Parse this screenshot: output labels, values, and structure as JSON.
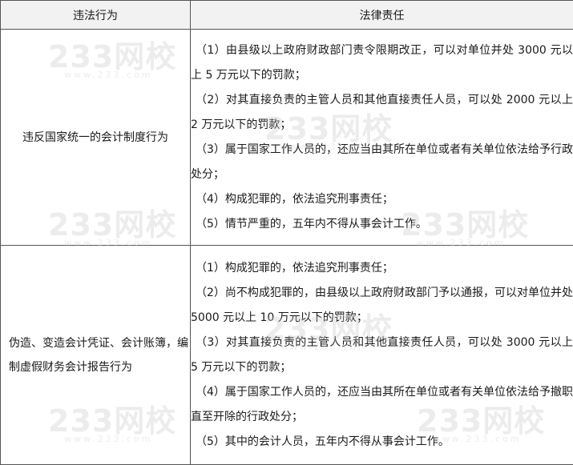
{
  "table": {
    "headers": [
      "违法行为",
      "法律责任"
    ],
    "rows": [
      {
        "act": "违反国家统一的会计制度行为",
        "items": [
          "（1）由县级以上政府财政部门责令限期改正，可以对单位并处 3000 元以上 5 万元以下的罚款；",
          "（2）对其直接负责的主管人员和其他直接责任人员，可以处 2000 元以上 2 万元以下的罚款；",
          "（3）属于国家工作人员的，还应当由其所在单位或者有关单位依法给予行政处分；",
          "（4）构成犯罪的，依法追究刑事责任；",
          "（5）情节严重的，五年内不得从事会计工作。"
        ]
      },
      {
        "act": "伪造、变造会计凭证、会计账簿，编制虚假财务会计报告行为",
        "items": [
          "（1）构成犯罪的，依法追究刑事责任；",
          "（2）尚不构成犯罪的，由县级以上政府财政部门予以通报，可以对单位并处 5000 元以上 10 万元以下的罚款；",
          "（3）对其直接负责的主管人员和其他直接责任人员，可以处 3000 元以上 5 万元以下的罚款；",
          "（4）属于国家工作人员的，还应当由其所在单位或者有关单位依法给予撤职直至开除的行政处分；",
          "（5）其中的会计人员，五年内不得从事会计工作。"
        ]
      }
    ]
  },
  "watermark": {
    "brand": "233网校",
    "site": "www.233.com"
  }
}
